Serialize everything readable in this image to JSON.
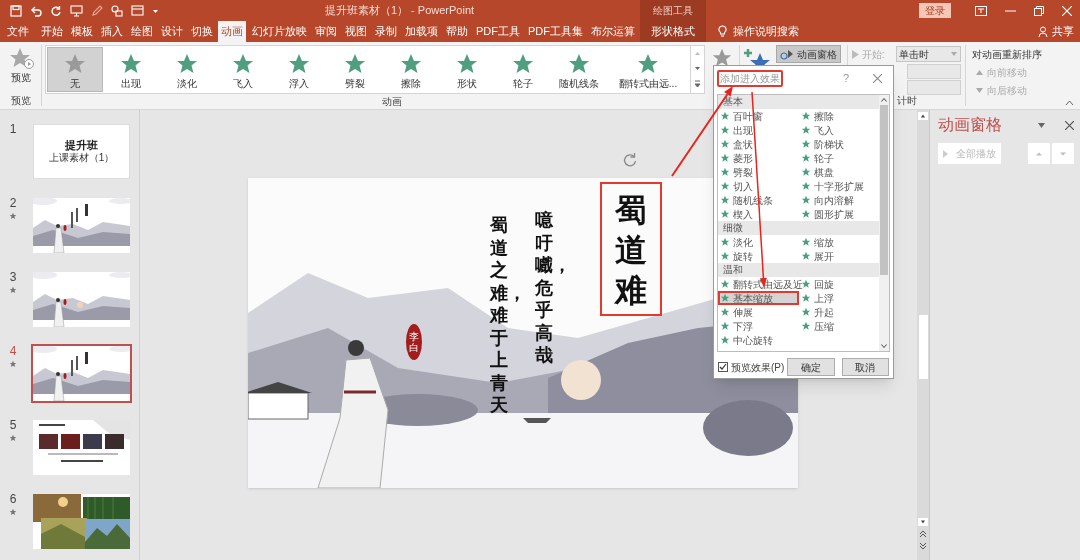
{
  "title_bar": {
    "title": "提升班素材（1） - PowerPoint",
    "context_label": "绘图工具",
    "login": "登录"
  },
  "tabs": [
    {
      "label": "文件",
      "selected": false,
      "kind": "file"
    },
    {
      "label": "开始",
      "selected": false,
      "kind": "tab"
    },
    {
      "label": "模板",
      "selected": false,
      "kind": "tab"
    },
    {
      "label": "插入",
      "selected": false,
      "kind": "tab"
    },
    {
      "label": "绘图",
      "selected": false,
      "kind": "tab"
    },
    {
      "label": "设计",
      "selected": false,
      "kind": "tab"
    },
    {
      "label": "切换",
      "selected": false,
      "kind": "tab"
    },
    {
      "label": "动画",
      "selected": true,
      "kind": "tab"
    },
    {
      "label": "幻灯片放映",
      "selected": false,
      "kind": "tab"
    },
    {
      "label": "审阅",
      "selected": false,
      "kind": "tab"
    },
    {
      "label": "视图",
      "selected": false,
      "kind": "tab"
    },
    {
      "label": "录制",
      "selected": false,
      "kind": "tab"
    },
    {
      "label": "加载项",
      "selected": false,
      "kind": "tab"
    },
    {
      "label": "帮助",
      "selected": false,
      "kind": "tab"
    },
    {
      "label": "PDF工具",
      "selected": false,
      "kind": "tab"
    },
    {
      "label": "PDF工具集",
      "selected": false,
      "kind": "tab"
    },
    {
      "label": "布尔运算",
      "selected": false,
      "kind": "tab"
    },
    {
      "label": "形状格式",
      "selected": false,
      "kind": "context"
    }
  ],
  "tell_me": "操作说明搜索",
  "share": "共享",
  "ribbon": {
    "preview": {
      "button": "预览",
      "group": "预览"
    },
    "gallery": {
      "group": "动画",
      "items": [
        {
          "label": "无",
          "selected": true
        },
        {
          "label": "出现",
          "selected": false
        },
        {
          "label": "淡化",
          "selected": false
        },
        {
          "label": "飞入",
          "selected": false
        },
        {
          "label": "浮入",
          "selected": false
        },
        {
          "label": "劈裂",
          "selected": false
        },
        {
          "label": "擦除",
          "selected": false
        },
        {
          "label": "形状",
          "selected": false
        },
        {
          "label": "轮子",
          "selected": false
        },
        {
          "label": "随机线条",
          "selected": false
        },
        {
          "label": "翻转式由远...",
          "selected": false
        }
      ]
    },
    "animation_pane_button": {
      "label": "动画窗格",
      "on": true
    },
    "timing": {
      "start_label": "开始:",
      "start_value": "单击时",
      "group": "计时"
    },
    "reorder": {
      "title": "对动画重新排序",
      "earlier": "向前移动",
      "later": "向后移动"
    }
  },
  "slides": [
    {
      "number": "1",
      "selected": false,
      "animated": false,
      "kind": "title",
      "title": "提升班",
      "subtitle": "上课素材（1）"
    },
    {
      "number": "2",
      "selected": false,
      "animated": true,
      "kind": "ink"
    },
    {
      "number": "3",
      "selected": false,
      "animated": true,
      "kind": "ink_plain"
    },
    {
      "number": "4",
      "selected": true,
      "animated": true,
      "kind": "ink"
    },
    {
      "number": "5",
      "selected": false,
      "animated": true,
      "kind": "cards"
    },
    {
      "number": "6",
      "selected": false,
      "animated": true,
      "kind": "photos"
    }
  ],
  "slide": {
    "title": "蜀道难",
    "lines": [
      "蜀道之难，难于上青天",
      "噫吁嚱，危乎高哉"
    ],
    "seal": "李白"
  },
  "dialog": {
    "title": "添加进入效果",
    "help": "?",
    "groups": [
      {
        "name": "基本",
        "items": [
          {
            "label": "百叶窗",
            "selected": false
          },
          {
            "label": "擦除",
            "selected": false
          },
          {
            "label": "出现",
            "selected": false
          },
          {
            "label": "飞入",
            "selected": false
          },
          {
            "label": "盒状",
            "selected": false
          },
          {
            "label": "阶梯状",
            "selected": false
          },
          {
            "label": "菱形",
            "selected": false
          },
          {
            "label": "轮子",
            "selected": false
          },
          {
            "label": "劈裂",
            "selected": false
          },
          {
            "label": "棋盘",
            "selected": false
          },
          {
            "label": "切入",
            "selected": false
          },
          {
            "label": "十字形扩展",
            "selected": false
          },
          {
            "label": "随机线条",
            "selected": false
          },
          {
            "label": "向内溶解",
            "selected": false
          },
          {
            "label": "楔入",
            "selected": false
          },
          {
            "label": "圆形扩展",
            "selected": false
          }
        ]
      },
      {
        "name": "细微",
        "items": [
          {
            "label": "淡化",
            "selected": false
          },
          {
            "label": "缩放",
            "selected": false
          },
          {
            "label": "旋转",
            "selected": false
          },
          {
            "label": "展开",
            "selected": false
          }
        ]
      },
      {
        "name": "温和",
        "items": [
          {
            "label": "翻转式由远及近",
            "selected": false
          },
          {
            "label": "回旋",
            "selected": false
          },
          {
            "label": "基本缩放",
            "selected": true
          },
          {
            "label": "上浮",
            "selected": false
          },
          {
            "label": "伸展",
            "selected": false
          },
          {
            "label": "升起",
            "selected": false
          },
          {
            "label": "下浮",
            "selected": false
          },
          {
            "label": "压缩",
            "selected": false
          },
          {
            "label": "中心旋转",
            "selected": false
          }
        ]
      }
    ],
    "preview_check": {
      "label": "预览效果(P)",
      "checked": true
    },
    "ok": "确定",
    "cancel": "取消"
  },
  "animation_pane": {
    "title": "动画窗格",
    "play_all": "全部播放"
  }
}
